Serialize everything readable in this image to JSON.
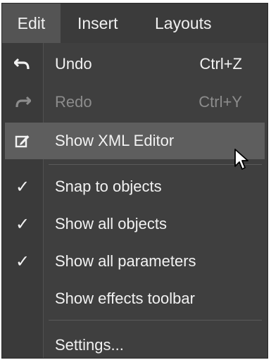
{
  "menubar": {
    "items": [
      {
        "label": "Edit"
      },
      {
        "label": "Insert"
      },
      {
        "label": "Layouts"
      }
    ]
  },
  "menu": {
    "undo": {
      "label": "Undo",
      "shortcut": "Ctrl+Z",
      "icon": "undo-icon"
    },
    "redo": {
      "label": "Redo",
      "shortcut": "Ctrl+Y",
      "icon": "redo-icon"
    },
    "xml_editor": {
      "label": "Show XML Editor",
      "icon": "edit-icon"
    },
    "snap": {
      "label": "Snap to objects",
      "checked": true
    },
    "all_objects": {
      "label": "Show all objects",
      "checked": true
    },
    "all_params": {
      "label": "Show all parameters",
      "checked": true
    },
    "effects_toolbar": {
      "label": "Show effects toolbar",
      "checked": false
    },
    "settings": {
      "label": "Settings..."
    }
  },
  "check_glyph": "✓",
  "colors": {
    "menu_bg": "#3f3f3f",
    "hover_bg": "#5e5e5e",
    "text": "#f2f2f2",
    "disabled_text": "#8c8c8c"
  }
}
